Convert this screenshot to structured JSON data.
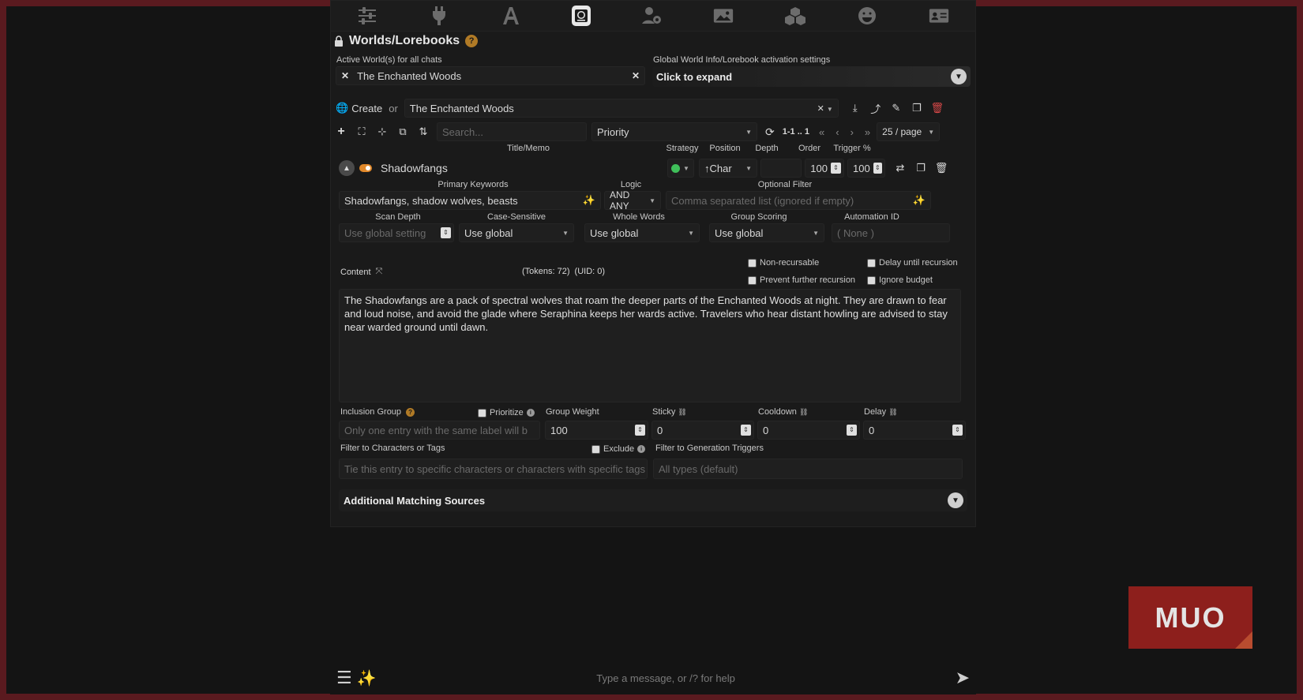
{
  "nav": {
    "icons": [
      "sliders-icon",
      "plug-icon",
      "font-icon",
      "book-atlas-icon",
      "user-gear-icon",
      "image-icon",
      "cubes-icon",
      "smile-icon",
      "id-card-icon"
    ],
    "active": "book-atlas-icon"
  },
  "header": {
    "title": "Worlds/Lorebooks",
    "help": "?"
  },
  "active_worlds": {
    "label": "Active World(s) for all chats",
    "chip": "The Enchanted Woods"
  },
  "global_settings": {
    "label": "Global World Info/Lorebook activation settings",
    "expand_label": "Click to expand"
  },
  "world_row": {
    "create_label": "Create",
    "or_label": "or",
    "selected_world": "The Enchanted Woods"
  },
  "toolbar": {
    "search_placeholder": "Search...",
    "sort_value": "Priority",
    "pagination": "1-1 .. 1",
    "per_page": "25 / page"
  },
  "columns": {
    "title": "Title/Memo",
    "strategy": "Strategy",
    "position": "Position",
    "depth": "Depth",
    "order": "Order",
    "trigger": "Trigger %"
  },
  "entry": {
    "title": "Shadowfangs",
    "position": "↑Char",
    "order": "100",
    "trigger": "100",
    "primary_keywords_label": "Primary Keywords",
    "primary_keywords": "Shadowfangs, shadow wolves, beasts",
    "logic_label": "Logic",
    "logic": "AND ANY",
    "optional_filter_label": "Optional Filter",
    "optional_filter_placeholder": "Comma separated list (ignored if empty)",
    "scan_depth_label": "Scan Depth",
    "scan_depth_placeholder": "Use global setting",
    "case_sensitive_label": "Case-Sensitive",
    "case_sensitive": "Use global",
    "whole_words_label": "Whole Words",
    "whole_words": "Use global",
    "group_scoring_label": "Group Scoring",
    "group_scoring": "Use global",
    "automation_id_label": "Automation ID",
    "automation_id_placeholder": "( None )",
    "content_label": "Content",
    "tokens": "(Tokens: 72)",
    "uid": "(UID: 0)",
    "non_recursable": "Non-recursable",
    "delay_until_recursion": "Delay until recursion",
    "prevent_further_recursion": "Prevent further recursion",
    "ignore_budget": "Ignore budget",
    "content": "The Shadowfangs are a pack of spectral wolves that roam the deeper parts of the Enchanted Woods at night. They are drawn to fear and loud noise, and avoid the glade where Seraphina keeps her wards active. Travelers who hear distant howling are advised to stay near warded ground until dawn.",
    "inclusion_group_label": "Inclusion Group",
    "prioritize_label": "Prioritize",
    "inclusion_group_placeholder": "Only one entry with the same label will b",
    "group_weight_label": "Group Weight",
    "group_weight": "100",
    "sticky_label": "Sticky",
    "sticky": "0",
    "cooldown_label": "Cooldown",
    "cooldown": "0",
    "delay_label": "Delay",
    "delay": "0",
    "filter_chars_label": "Filter to Characters or Tags",
    "exclude_label": "Exclude",
    "filter_chars_placeholder": "Tie this entry to specific characters or characters with specific tags",
    "filter_triggers_label": "Filter to Generation Triggers",
    "filter_triggers_placeholder": "All types (default)",
    "additional_sources": "Additional Matching Sources"
  },
  "chat": {
    "placeholder": "Type a message, or /? for help"
  },
  "watermark": "MUO",
  "colors": {
    "toggle_orange": "#e0882a",
    "status_green": "#3fbf5a",
    "delete_red": "#d64848"
  }
}
